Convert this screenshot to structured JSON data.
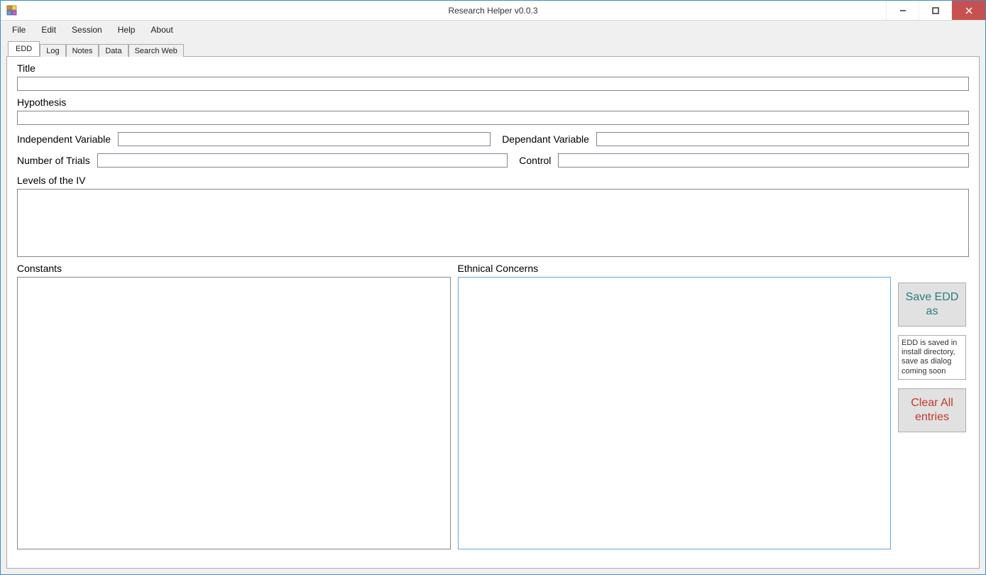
{
  "window": {
    "title": "Research Helper v0.0.3"
  },
  "menu": {
    "items": [
      "File",
      "Edit",
      "Session",
      "Help",
      "About"
    ]
  },
  "tabs": {
    "items": [
      "EDD",
      "Log",
      "Notes",
      "Data",
      "Search Web"
    ],
    "active_index": 0
  },
  "form": {
    "title_label": "Title",
    "title_value": "",
    "hypothesis_label": "Hypothesis",
    "hypothesis_value": "",
    "independent_label": "Independent Variable",
    "independent_value": "",
    "dependent_label": "Dependant Variable",
    "dependent_value": "",
    "trials_label": "Number of Trials",
    "trials_value": "",
    "control_label": "Control",
    "control_value": "",
    "levels_label": "Levels of the IV",
    "levels_value": "",
    "constants_label": "Constants",
    "constants_value": "",
    "ethical_label": "Ethnical Concerns",
    "ethical_value": ""
  },
  "actions": {
    "save_label": "Save EDD as",
    "info_text": "EDD is saved in install directory, save as dialog coming soon",
    "clear_label": "Clear All entries"
  }
}
